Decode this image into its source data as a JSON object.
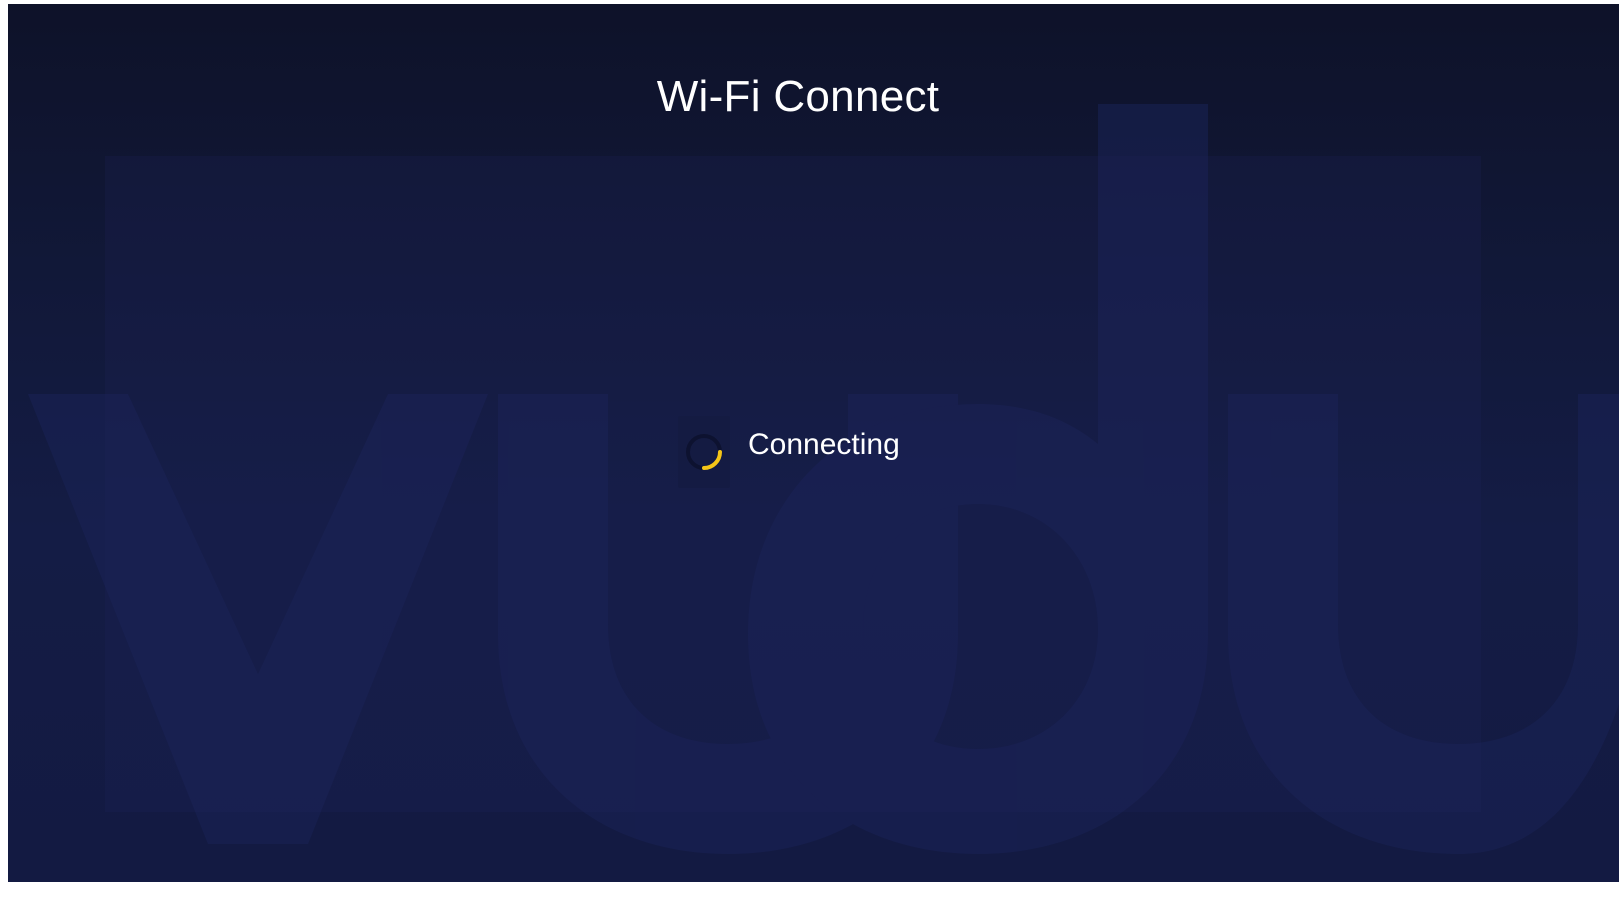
{
  "screen": {
    "title": "Wi-Fi Connect",
    "status_text": "Connecting",
    "spinner_icon": "loading-spinner-icon",
    "watermark_logo": "vudu-logo",
    "colors": {
      "accent": "#f5c518",
      "background_top": "#0e1229",
      "background_bottom": "#141c45",
      "text": "#ffffff"
    }
  }
}
